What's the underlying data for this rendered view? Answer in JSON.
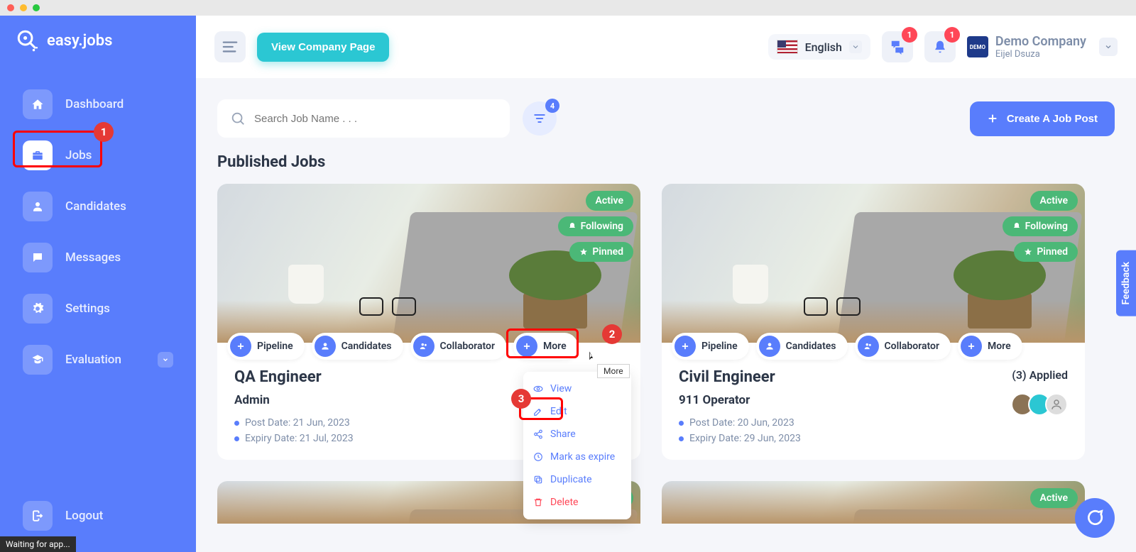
{
  "logo": {
    "text": "easy.jobs"
  },
  "sidebar": {
    "items": [
      {
        "label": "Dashboard"
      },
      {
        "label": "Jobs"
      },
      {
        "label": "Candidates"
      },
      {
        "label": "Messages"
      },
      {
        "label": "Settings"
      },
      {
        "label": "Evaluation"
      }
    ],
    "logout": "Logout"
  },
  "topbar": {
    "view_company": "View Company Page",
    "language": "English",
    "notification_badges": {
      "chat": "1",
      "bell": "1"
    },
    "company": {
      "name": "Demo Company",
      "user": "Eijel Dsuza"
    }
  },
  "search": {
    "placeholder": "Search Job Name . . ."
  },
  "filter_badge": "4",
  "create_button": "Create A Job Post",
  "section_title": "Published Jobs",
  "chip_labels": {
    "pipeline": "Pipeline",
    "candidates": "Candidates",
    "collaborator": "Collaborator",
    "more": "More"
  },
  "status_labels": {
    "active": "Active",
    "following": "Following",
    "pinned": "Pinned"
  },
  "jobs": [
    {
      "title": "QA Engineer",
      "subtitle": "Admin",
      "post_date": "Post Date: 21 Jun, 2023",
      "expiry_date": "Expiry Date: 21 Jul, 2023"
    },
    {
      "title": "Civil Engineer",
      "subtitle": "911 Operator",
      "post_date": "Post Date: 20 Jun, 2023",
      "expiry_date": "Expiry Date: 29 Jun, 2023",
      "applied": "(3) Applied"
    }
  ],
  "dropdown": {
    "tooltip": "More",
    "view": "View",
    "edit": "Edit",
    "share": "Share",
    "mark_expire": "Mark as expire",
    "duplicate": "Duplicate",
    "delete": "Delete"
  },
  "annotations": {
    "1": "1",
    "2": "2",
    "3": "3"
  },
  "feedback": "Feedback",
  "status_bar": "Waiting for app..."
}
